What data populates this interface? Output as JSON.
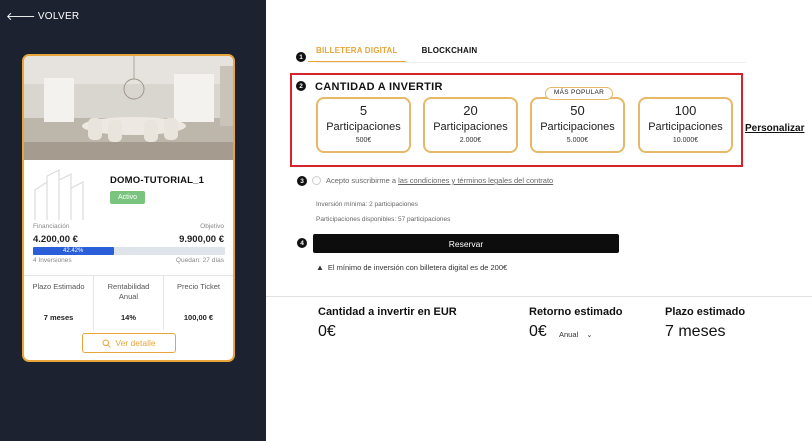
{
  "nav": {
    "back_label": "VOLVER"
  },
  "property": {
    "name": "DOMO-TUTORIAL_1",
    "status": "Activo",
    "financing_label": "Financiación",
    "financing_value": "4.200,00 €",
    "objective_label": "Objetivo",
    "objective_value": "9.900,00 €",
    "progress_percent": 42.42,
    "progress_label": "42.42%",
    "investments": "4 Inversiones",
    "remaining": "Quedan: 27 días",
    "stats": [
      {
        "label": "Plazo Estimado",
        "value": "7 meses"
      },
      {
        "label": "Rentabilidad Anual",
        "value": "14%"
      },
      {
        "label": "Precio Ticket",
        "value": "100,00 €"
      }
    ],
    "detail_button": "Ver detalle"
  },
  "steps": [
    "1",
    "2",
    "3",
    "4"
  ],
  "tabs": [
    {
      "label": "BILLETERA DIGITAL",
      "active": true
    },
    {
      "label": "BLOCKCHAIN",
      "active": false
    }
  ],
  "amount": {
    "title": "CANTIDAD A INVERTIR",
    "popular_badge": "MÁS POPULAR",
    "options": [
      {
        "number": "5",
        "unit": "Participaciones",
        "price": "500€"
      },
      {
        "number": "20",
        "unit": "Participaciones",
        "price": "2.000€"
      },
      {
        "number": "50",
        "unit": "Participaciones",
        "price": "5.000€"
      },
      {
        "number": "100",
        "unit": "Participaciones",
        "price": "10.000€"
      }
    ],
    "custom_label": "Personalizar"
  },
  "terms": {
    "prefix": "Acepto suscribirme a",
    "link": "las condiciones y términos legales del contrato"
  },
  "limits": {
    "min_investment": "Inversión mínima: 2 participaciones",
    "available": "Participaciones disponibles: 57 participaciones"
  },
  "reserve_button": "Reservar",
  "warning": "El mínimo de inversión con billetera digital es de 200€",
  "summary": {
    "amount_label": "Cantidad a invertir en EUR",
    "amount_value": "0€",
    "return_label": "Retorno estimado",
    "return_value": "0€",
    "return_period": "Anual",
    "term_label": "Plazo estimado",
    "term_value": "7 meses"
  },
  "colors": {
    "sidebar_bg": "#1c2230",
    "accent": "#e8a53a",
    "highlight": "#d8222b",
    "progress": "#2b5fd9",
    "active_badge": "#7bc47f"
  }
}
